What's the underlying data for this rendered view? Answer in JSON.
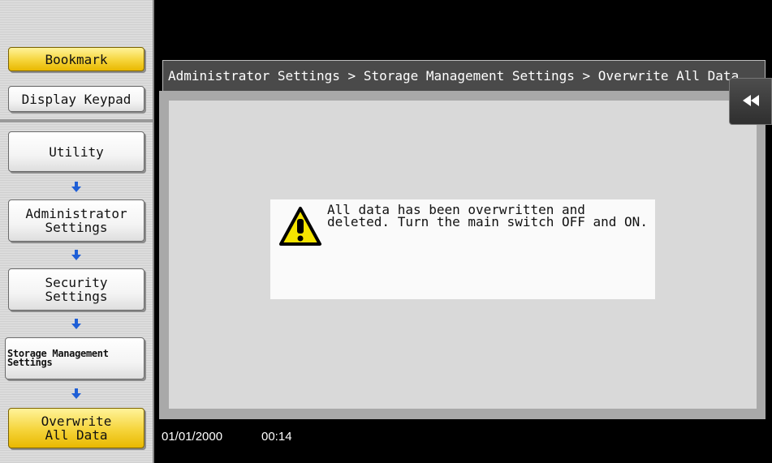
{
  "sidebar": {
    "bookmark_label": "Bookmark",
    "display_keypad_label": "Display Keypad",
    "breadcrumb_steps": [
      {
        "line1": "Utility",
        "line2": ""
      },
      {
        "line1": "Administrator",
        "line2": "Settings"
      },
      {
        "line1": "Security",
        "line2": "Settings"
      },
      {
        "line1": "Storage Management",
        "line2": "Settings"
      },
      {
        "line1": "Overwrite",
        "line2": "All Data"
      }
    ]
  },
  "header": {
    "path": "Administrator Settings > Storage Management Settings > Overwrite All Data"
  },
  "message": {
    "line1": "All data has been overwritten and",
    "line2": "deleted. Turn the main switch OFF and ON."
  },
  "status": {
    "date": "01/01/2000",
    "time": "00:14"
  },
  "icons": {
    "back": "rewind-icon",
    "warning": "warning-icon",
    "step_arrow": "arrow-down-icon"
  },
  "colors": {
    "active_button": "#f5d43a",
    "arrow": "#1f5fd6",
    "header_bg": "#4a4a4a"
  }
}
